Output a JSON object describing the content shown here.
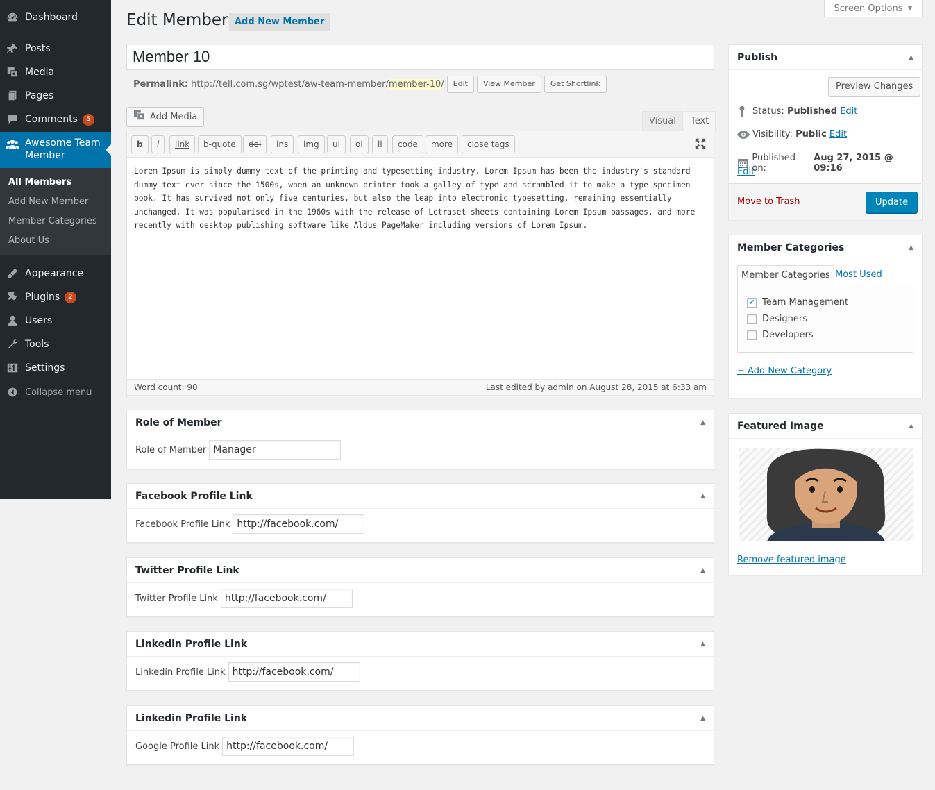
{
  "menu": {
    "items": [
      {
        "label": "Dashboard",
        "icon": "dashboard-icon"
      },
      {
        "label": "Posts",
        "icon": "pin-icon"
      },
      {
        "label": "Media",
        "icon": "media-icon"
      },
      {
        "label": "Pages",
        "icon": "pages-icon"
      },
      {
        "label": "Comments",
        "icon": "comments-icon",
        "badge": "5"
      },
      {
        "label": "Awesome Team Member",
        "icon": "team-icon"
      },
      {
        "label": "Appearance",
        "icon": "brush-icon"
      },
      {
        "label": "Plugins",
        "icon": "plugin-icon",
        "badge": "2"
      },
      {
        "label": "Users",
        "icon": "users-icon"
      },
      {
        "label": "Tools",
        "icon": "wrench-icon"
      },
      {
        "label": "Settings",
        "icon": "settings-icon"
      }
    ],
    "submenu": [
      "All Members",
      "Add New Member",
      "Member Categories",
      "About Us"
    ],
    "collapse_label": "Collapse menu"
  },
  "header": {
    "title": "Edit Member",
    "add_new": "Add New Member",
    "screen_options": "Screen Options"
  },
  "post": {
    "title": "Member 10",
    "permalink_label": "Permalink:",
    "permalink_base": "http://tell.com.sg/wptest/aw-team-member/",
    "permalink_slug": "member-10",
    "permalink_end": "/",
    "edit_btn": "Edit",
    "view_btn": "View Member",
    "shortlink_btn": "Get Shortlink"
  },
  "editor": {
    "add_media": "Add Media",
    "tab_visual": "Visual",
    "tab_text": "Text",
    "quicktags": [
      "b",
      "i",
      "link",
      "b-quote",
      "del",
      "ins",
      "img",
      "ul",
      "ol",
      "li",
      "code",
      "more",
      "close tags"
    ],
    "content": "Lorem Ipsum is simply dummy text of the printing and typesetting industry. Lorem Ipsum has been the industry's standard dummy text ever since the 1500s, when an unknown printer took a galley of type and scrambled it to make a type specimen book. It has survived not only five centuries, but also the leap into electronic typesetting, remaining essentially unchanged. It was popularised in the 1960s with the release of Letraset sheets containing Lorem Ipsum passages, and more recently with desktop publishing software like Aldus PageMaker including versions of Lorem Ipsum.",
    "word_count": "Word count: 90",
    "last_edited": "Last edited by admin on August 28, 2015 at 6:33 am"
  },
  "metaboxes": [
    {
      "title": "Role of Member",
      "label": "Role of Member",
      "value": "Manager"
    },
    {
      "title": "Facebook Profile Link",
      "label": "Facebook Profile Link",
      "value": "http://facebook.com/"
    },
    {
      "title": "Twitter Profile Link",
      "label": "Twitter Profile Link",
      "value": "http://facebook.com/"
    },
    {
      "title": "Linkedin Profile Link",
      "label": "Linkedin Profile Link",
      "value": "http://facebook.com/"
    },
    {
      "title": "Linkedin Profile Link",
      "label": "Google Profile Link",
      "value": "http://facebook.com/"
    }
  ],
  "publish": {
    "title": "Publish",
    "preview": "Preview Changes",
    "status_label": "Status:",
    "status_value": "Published",
    "visibility_label": "Visibility:",
    "visibility_value": "Public",
    "published_label": "Published on:",
    "published_value": "Aug 27, 2015 @ 09:16",
    "edit": "Edit",
    "trash": "Move to Trash",
    "update": "Update"
  },
  "categories": {
    "title": "Member Categories",
    "tab_all": "Member Categories",
    "tab_used": "Most Used",
    "items": [
      {
        "label": "Team Management",
        "checked": true
      },
      {
        "label": "Designers",
        "checked": false
      },
      {
        "label": "Developers",
        "checked": false
      }
    ],
    "add_new": "+ Add New Category"
  },
  "featured": {
    "title": "Featured Image",
    "remove": "Remove featured image"
  },
  "colors": {
    "menu_bg": "#23282d",
    "menu_active": "#0073aa",
    "badge": "#ca4a1f",
    "primary": "#0085ba",
    "trash": "#a00"
  }
}
